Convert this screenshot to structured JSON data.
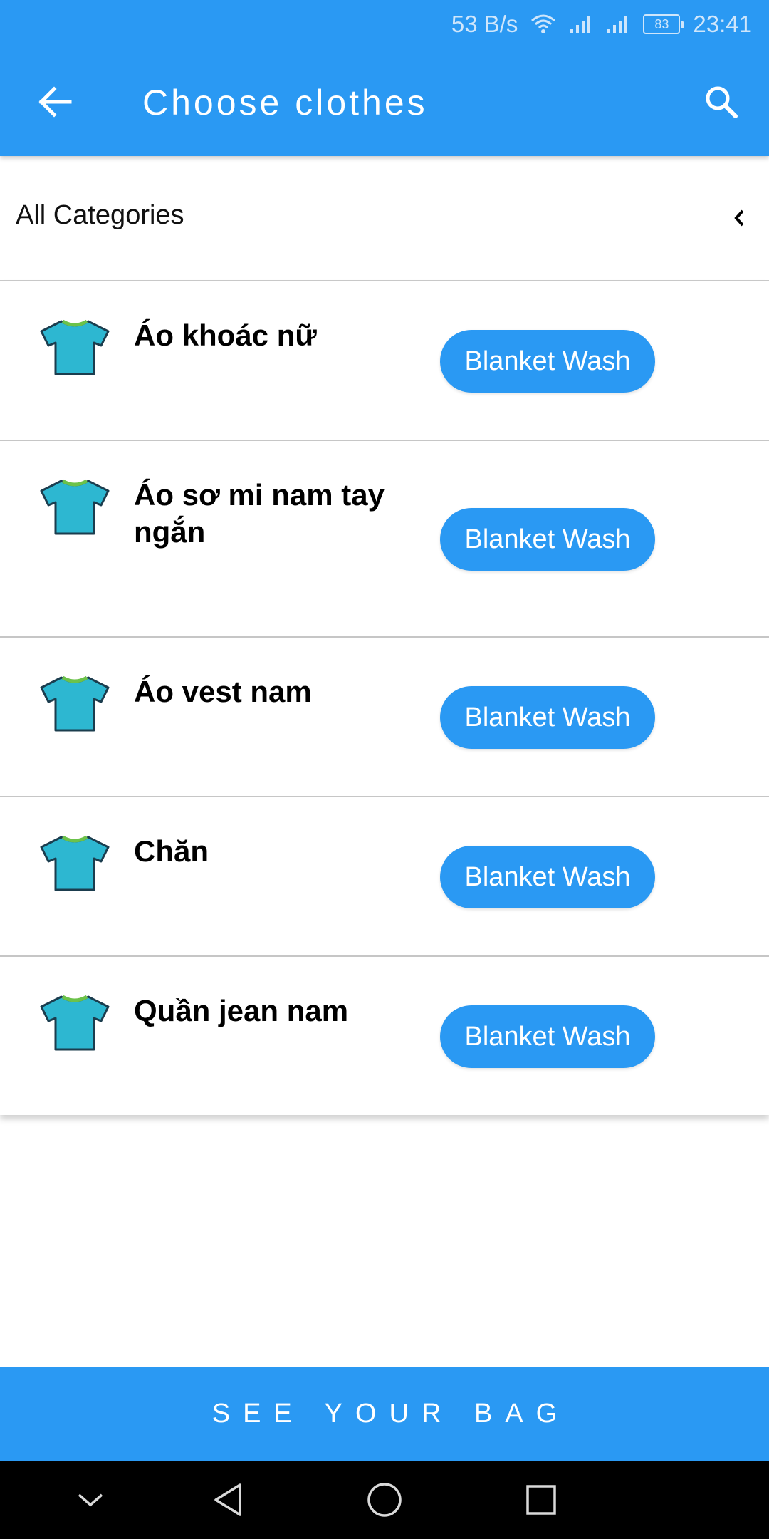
{
  "status_bar": {
    "net_speed": "53 B/s",
    "battery": "83",
    "time": "23:41"
  },
  "app_bar": {
    "title": "Choose clothes"
  },
  "category": {
    "label": "All Categories"
  },
  "items": [
    {
      "name": "Áo khoác nữ",
      "action": "Blanket Wash",
      "icon": "tshirt-icon"
    },
    {
      "name": "Áo sơ mi nam tay ngắn",
      "action": "Blanket Wash",
      "icon": "tshirt-icon"
    },
    {
      "name": "Áo vest nam",
      "action": "Blanket Wash",
      "icon": "tshirt-icon"
    },
    {
      "name": "Chăn",
      "action": "Blanket Wash",
      "icon": "tshirt-icon"
    },
    {
      "name": "Quần jean nam",
      "action": "Blanket Wash",
      "icon": "tshirt-icon"
    }
  ],
  "bag_button": {
    "label": "SEE YOUR BAG"
  },
  "colors": {
    "primary": "#2a99f3",
    "tshirt": "#2db7d1",
    "collar": "#6cc24a"
  }
}
